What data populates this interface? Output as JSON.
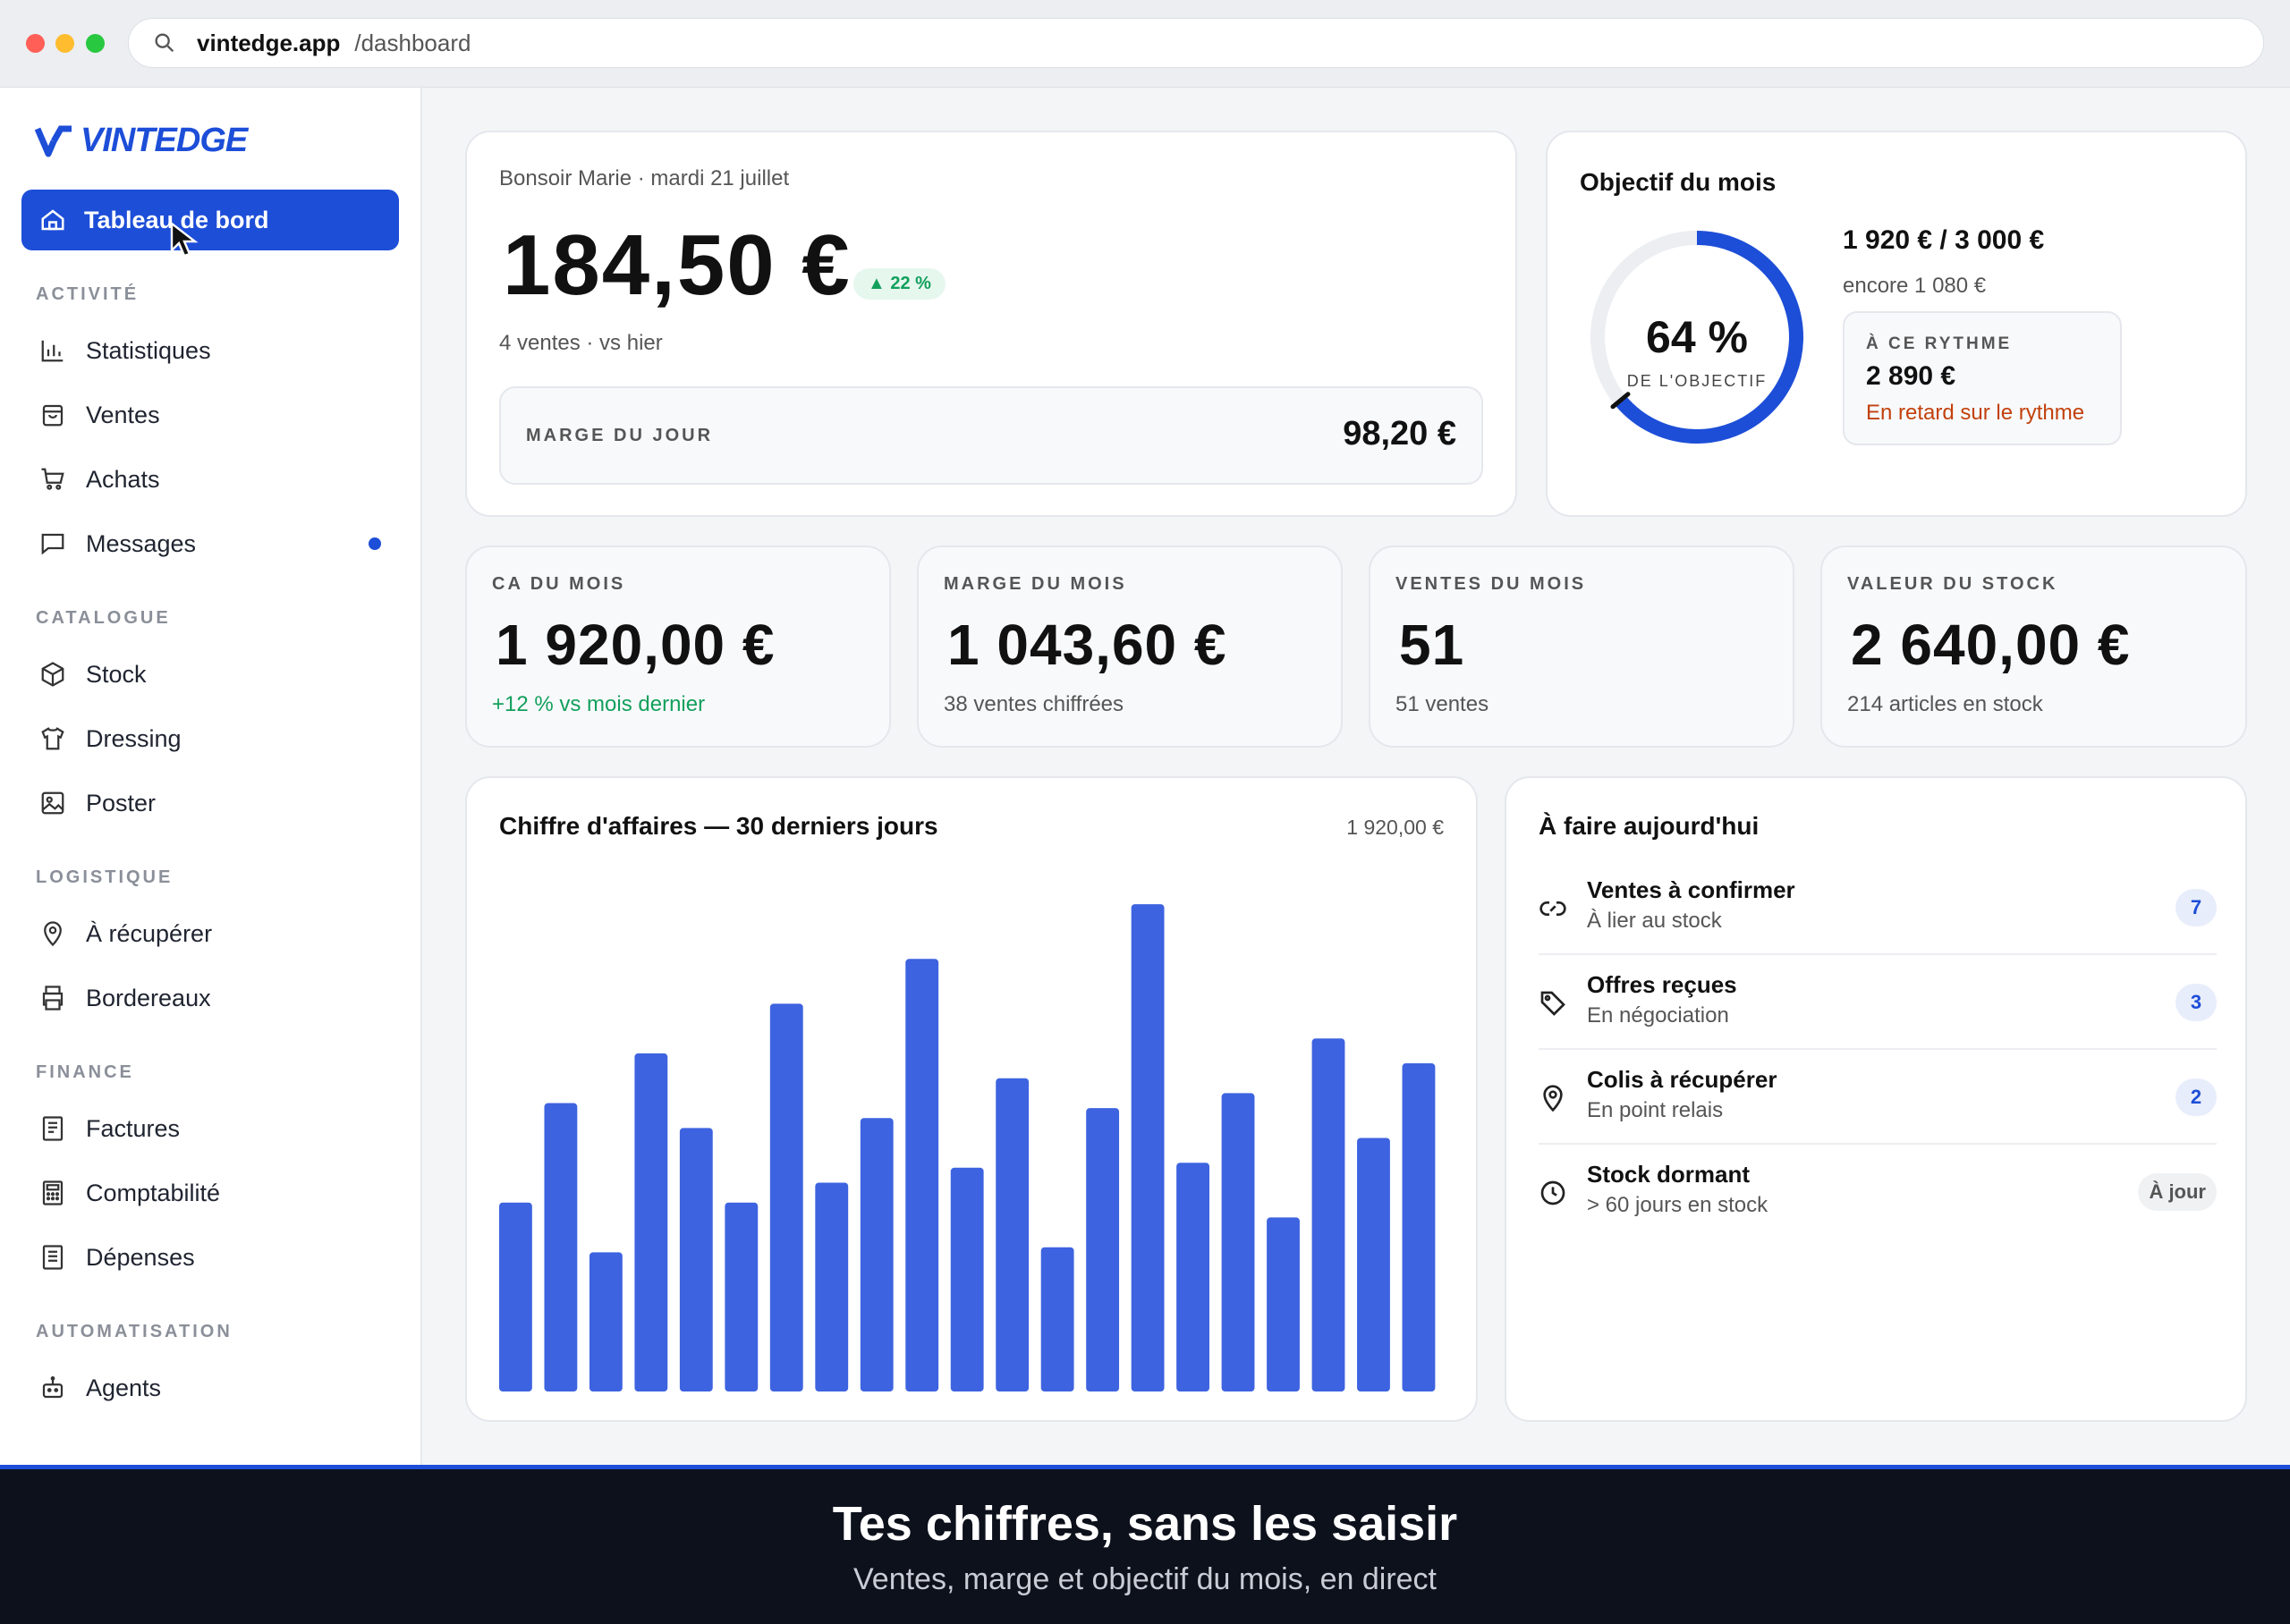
{
  "browser": {
    "host": "vintedge.app",
    "path": "/dashboard"
  },
  "sidebar": {
    "logo": "VINTEDGE",
    "active": "Tableau de bord",
    "sections": {
      "activite": "ACTIVITÉ",
      "catalogue": "CATALOGUE",
      "logistique": "LOGISTIQUE",
      "finance": "FINANCE",
      "automatisation": "AUTOMATISATION"
    },
    "items": {
      "statistiques": "Statistiques",
      "ventes": "Ventes",
      "achats": "Achats",
      "messages": "Messages",
      "stock": "Stock",
      "dressing": "Dressing",
      "poster": "Poster",
      "recuperer": "À récupérer",
      "bordereaux": "Bordereaux",
      "factures": "Factures",
      "comptabilite": "Comptabilité",
      "depenses": "Dépenses",
      "agents": "Agents"
    }
  },
  "today": {
    "greeting": "Bonsoir Marie · mardi 21 juillet",
    "amount": "184,50 €",
    "change": "▲ 22 %",
    "subline": "4 ventes · vs hier",
    "marge_label": "MARGE DU JOUR",
    "marge_value": "98,20 €"
  },
  "objective": {
    "title": "Objectif du mois",
    "percent": "64 %",
    "percent_value": 64,
    "percent_label": "DE L'OBJECTIF",
    "amount": "1 920 € / 3 000 €",
    "remaining": "encore 1 080 €",
    "rythme_label": "À CE RYTHME",
    "rythme_value": "2 890 €",
    "rythme_note": "En retard sur le rythme"
  },
  "kpis": [
    {
      "label": "CA DU MOIS",
      "value": "1 920,00 €",
      "note": "+12 % vs mois dernier"
    },
    {
      "label": "MARGE DU MOIS",
      "value": "1 043,60 €",
      "note": "38 ventes chiffrées"
    },
    {
      "label": "VENTES DU MOIS",
      "value": "51",
      "note": "51 ventes"
    },
    {
      "label": "VALEUR DU STOCK",
      "value": "2 640,00 €",
      "note": "214 articles en stock"
    }
  ],
  "chart": {
    "title": "Chiffre d'affaires — 30 derniers jours",
    "total": "1 920,00 €"
  },
  "chart_data": {
    "type": "bar",
    "title": "Chiffre d'affaires — 30 derniers jours",
    "color": "#3d63e0",
    "values": [
      38,
      58,
      28,
      68,
      53,
      38,
      78,
      42,
      55,
      87,
      45,
      63,
      29,
      57,
      98,
      46,
      60,
      35,
      71,
      51,
      66
    ],
    "ylim": [
      0,
      100
    ]
  },
  "todo": {
    "title": "À faire aujourd'hui",
    "items": [
      {
        "name": "Ventes à confirmer",
        "sub": "À lier au stock",
        "count": "7"
      },
      {
        "name": "Offres reçues",
        "sub": "En négociation",
        "count": "3"
      },
      {
        "name": "Colis à récupérer",
        "sub": "En point relais",
        "count": "2"
      },
      {
        "name": "Stock dormant",
        "sub": "> 60 jours en stock",
        "count": "À jour"
      }
    ]
  },
  "banner": {
    "title": "Tes chiffres, sans les saisir",
    "subtitle": "Ventes, marge et objectif du mois, en direct"
  },
  "colors": {
    "accent": "#1d4ed8",
    "bar": "#3d63e0",
    "positive": "#12a05c",
    "warning": "#c2410c"
  }
}
